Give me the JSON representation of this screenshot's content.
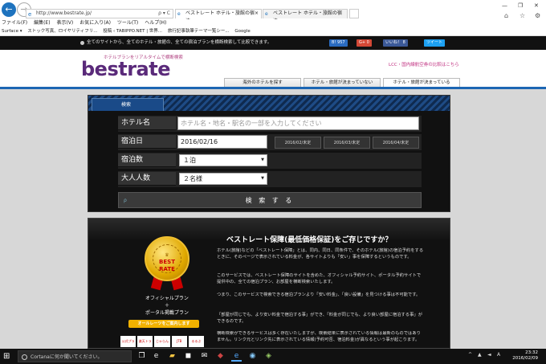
{
  "browser": {
    "address": "http://www.bestrate.jp/",
    "address_controls": "ρ ▾ C",
    "tabs": [
      {
        "label": "ベストレート ホテル・旅館の宿泊..."
      },
      {
        "label": "ベストレート ホテル・旅館の宿泊..."
      }
    ],
    "menu": [
      "ファイル(F)",
      "編集(E)",
      "表示(V)",
      "お気に入り(A)",
      "ツール(T)",
      "ヘルプ(H)"
    ],
    "favorites": [
      "Surface ▾",
      "ストック写真、ロイヤリティフリ...",
      "投稿 ‹ TABIPPO.NET | 世界...",
      "旅行記事執筆テーマ一覧シー...",
      "Google"
    ]
  },
  "site": {
    "notice": "全てのサイトから、全てのホテル・旅館の、全ての宿泊プランを横断検索して比較できます。",
    "social": {
      "bookmark_count": "957",
      "gplus": "G+",
      "gplus_count": "0",
      "like": "いいね！",
      "like_count": "8",
      "tweet": "ツイート"
    },
    "logo_sub": "ホテルプランをリアルタイムで横断検索",
    "logo": "bestrate",
    "lcc_link": "LCC・国内線航空券の比較はこちら",
    "nav_tabs": [
      "海外のホテルを探す",
      "ホテル・旅館が決まっていない",
      "ホテル・旅館が決まっている"
    ]
  },
  "search": {
    "tab_label": "検索",
    "hotel_label": "ホテル名",
    "hotel_placeholder": "ホテル名・地名・駅名の一部を入力してください",
    "date_label": "宿泊日",
    "date_value": "2016/02/16",
    "month_buttons": [
      "2016/02/未定",
      "2016/03/未定",
      "2016/04/未定"
    ],
    "nights_label": "宿泊数",
    "nights_value": "１泊",
    "adults_label": "大人人数",
    "adults_value": "２名様",
    "submit_label": "検 索 す る",
    "submit_icon": "ρ"
  },
  "promo": {
    "medal_line1": "BEST",
    "medal_line2": "RATE",
    "plan_line1": "オフィシャルプラン",
    "plan_line2": "＋",
    "plan_line3": "ポータル掲載プラン",
    "button": "オールレーツをご案内します",
    "logos": [
      "公式プラン",
      "楽天トラベル",
      "じゃらん",
      "JTB",
      "るるぶ"
    ],
    "title": "ベストレート保障(最低価格保証)をご存じですか？",
    "paragraphs": [
      "ホテル(旅館)などの「ベストレート保障」とは、同内、同日、同条件で、そのホテル(旅館)の宿泊予約をするときに、そのページで表示されている料金が、各サイトよりも「安い」事を保障するというものです。",
      "このサービスでは、ベストレート保障のサイトを含めた、オフィシャル予約サイト、ポータル予約サイトで提供中の、全ての宿泊プラン、お部屋を横断検索いたします。",
      "つまり、このサービスで検索できる宿泊プランより「安い料金」、「良い設備」を見つける事は不可能です。",
      "「部屋が同じでも、より安い料金で宿泊する事」ができ、「料金が同じでも、より良い部屋に宿泊する事」ができるのです。",
      "横断検索ができるサービスは多く存在いたしますが、検索結果に表示されている情報は最新のものではありません。リンク元とリンク先に表示されている情報(予約可否、宿泊料金)が異なるという事が起こります。"
    ]
  },
  "taskbar": {
    "cortana": "Cortanaに何か聞いてください。",
    "time": "23:32",
    "date": "2016/02/09"
  }
}
